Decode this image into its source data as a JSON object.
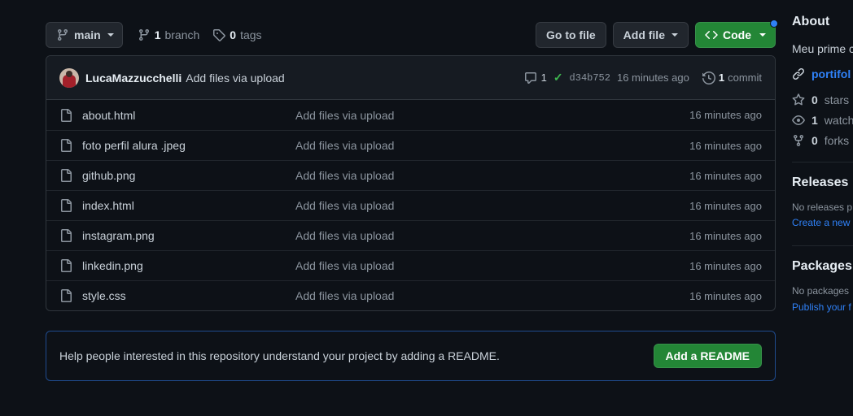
{
  "colors": {
    "bg": "#0d1117",
    "panel": "#161b22",
    "border": "#30363d",
    "green": "#238636",
    "blue": "#2f81f7",
    "check_green": "#3fb950",
    "banner_border": "#1f4b8e",
    "muted": "#8b949e"
  },
  "toolbar": {
    "branch_icon": "branch-icon",
    "branch_label": "main",
    "branches_count": "1",
    "branches_label": "branch",
    "tags_count": "0",
    "tags_label": "tags",
    "go_to_file_label": "Go to file",
    "add_file_label": "Add file",
    "code_label": "Code"
  },
  "commit_header": {
    "author": "LucaMazzucchelli",
    "message": "Add files via upload",
    "comments_count": "1",
    "status": "✓",
    "sha": "d34b752",
    "time": "16 minutes ago",
    "commits_count": "1",
    "commits_label": "commit"
  },
  "files": [
    {
      "name": "about.html",
      "message": "Add files via upload",
      "time": "16 minutes ago"
    },
    {
      "name": "foto perfil alura .jpeg",
      "message": "Add files via upload",
      "time": "16 minutes ago"
    },
    {
      "name": "github.png",
      "message": "Add files via upload",
      "time": "16 minutes ago"
    },
    {
      "name": "index.html",
      "message": "Add files via upload",
      "time": "16 minutes ago"
    },
    {
      "name": "instagram.png",
      "message": "Add files via upload",
      "time": "16 minutes ago"
    },
    {
      "name": "linkedin.png",
      "message": "Add files via upload",
      "time": "16 minutes ago"
    },
    {
      "name": "style.css",
      "message": "Add files via upload",
      "time": "16 minutes ago"
    }
  ],
  "readme_banner": {
    "text": "Help people interested in this repository understand your project by adding a README.",
    "button_label": "Add a README"
  },
  "sidebar": {
    "about_title": "About",
    "description": "Meu prime​ com curso",
    "website_link": "portifol",
    "stars_count": "0",
    "stars_label": "stars",
    "watching_count": "1",
    "watching_label": "watch",
    "forks_count": "0",
    "forks_label": "forks",
    "releases_title": "Releases",
    "releases_empty": "No releases p",
    "releases_action": "Create a new",
    "packages_title": "Packages",
    "packages_empty": "No packages",
    "packages_action": "Publish your f"
  }
}
